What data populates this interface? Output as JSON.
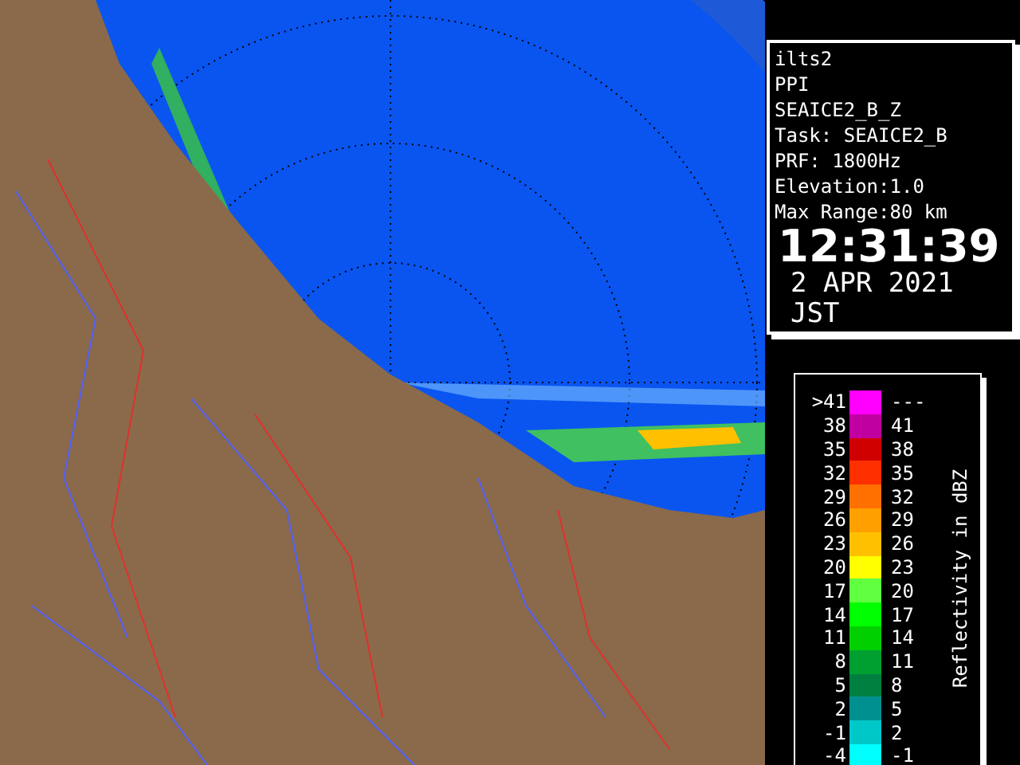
{
  "info": {
    "lines": [
      "ilts2",
      "PPI",
      "SEAICE2_B_Z",
      "Task: SEAICE2_B",
      "PRF: 1800Hz",
      "Elevation:1.0",
      "Max Range:80 km"
    ],
    "time": "12:31:39",
    "date": "2 APR 2021 JST"
  },
  "legend": {
    "title": "Reflectivity in dBZ",
    "rows": [
      {
        "low": ">41",
        "high": "---",
        "color": "#ff00ff"
      },
      {
        "low": "38",
        "high": "41",
        "color": "#c000a0"
      },
      {
        "low": "35",
        "high": "38",
        "color": "#d00000"
      },
      {
        "low": "32",
        "high": "35",
        "color": "#ff3000"
      },
      {
        "low": "29",
        "high": "32",
        "color": "#ff7000"
      },
      {
        "low": "26",
        "high": "29",
        "color": "#ffa000"
      },
      {
        "low": "23",
        "high": "26",
        "color": "#ffc000"
      },
      {
        "low": "20",
        "high": "23",
        "color": "#ffff00"
      },
      {
        "low": "17",
        "high": "20",
        "color": "#60ff40"
      },
      {
        "low": "14",
        "high": "17",
        "color": "#00ff00"
      },
      {
        "low": "11",
        "high": "14",
        "color": "#00d000"
      },
      {
        "low": "8",
        "high": "11",
        "color": "#00a030"
      },
      {
        "low": "5",
        "high": "8",
        "color": "#008040"
      },
      {
        "low": "2",
        "high": "5",
        "color": "#009090"
      },
      {
        "low": "-1",
        "high": "2",
        "color": "#00c8c8"
      },
      {
        "low": "-4",
        "high": "-1",
        "color": "#00ffff"
      }
    ]
  }
}
